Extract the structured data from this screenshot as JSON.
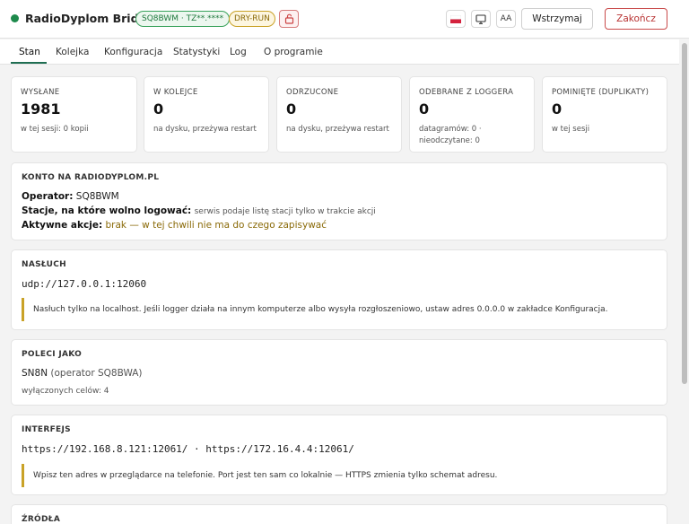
{
  "header": {
    "app_title": "RadioDyplom Bridge",
    "callsign_badge": "SQ8BWM · TZ**.****",
    "dry_run_badge": "DRY-RUN",
    "pause_label": "Wstrzymaj",
    "quit_label": "Zakończ",
    "font_size_label": "AA",
    "lock_icon": "lock-icon",
    "monitor_icon": "monitor-icon",
    "flag_icon": "poland-flag-icon"
  },
  "tabs": [
    {
      "label": "Stan"
    },
    {
      "label": "Kolejka"
    },
    {
      "label": "Konfiguracja"
    },
    {
      "label": "Statystyki"
    },
    {
      "label": "Log"
    },
    {
      "label": "O programie"
    }
  ],
  "stats": [
    {
      "label": "WYSŁANE",
      "value": "1981",
      "note": "w tej sesji: 0 kopii"
    },
    {
      "label": "W KOLEJCE",
      "value": "0",
      "note": "na dysku, przeżywa restart"
    },
    {
      "label": "ODRZUCONE",
      "value": "0",
      "note": "na dysku, przeżywa restart"
    },
    {
      "label": "ODEBRANE Z LOGGERA",
      "value": "0",
      "note": "datagramów: 0 · nieodczytane: 0"
    },
    {
      "label": "POMINIĘTE (DUPLIKATY)",
      "value": "0",
      "note": "w tej sesji"
    }
  ],
  "account": {
    "title": "KONTO NA RADIODYPLOM.PL",
    "operator_label": "Operator:",
    "operator_value": "SQ8BWM",
    "stations_label": "Stacje, na które wolno logować:",
    "stations_value": "serwis podaje listę stacji tylko w trakcie akcji",
    "actions_label": "Aktywne akcje:",
    "actions_value": "brak — w tej chwili nie ma do czego zapisywać"
  },
  "listen": {
    "title": "NASŁUCH",
    "address": "udp://127.0.0.1:12060",
    "note": "Nasłuch tylko na localhost. Jeśli logger działa na innym komputerze albo wysyła rozgłoszeniowo, ustaw adres 0.0.0.0 w zakładce Konfiguracja."
  },
  "send_as": {
    "title": "POLECI JAKO",
    "station": "SN8N",
    "operator": "(operator SQ8BWA)",
    "disabled": "wyłączonych celów: 4"
  },
  "interface": {
    "title": "INTERFEJS",
    "urls": "https://192.168.8.121:12061/ · https://172.16.4.4:12061/",
    "note": "Wpisz ten adres w przeglądarce na telefonie. Port jest ten sam co lokalnie — HTTPS zmienia tylko schemat adresu."
  },
  "sources": {
    "title": "ŹRÓDŁA"
  },
  "colors": {
    "accent": "#1f6e52",
    "ok": "#1e8a4c",
    "warn": "#c9a227",
    "danger": "#c94a4a"
  }
}
